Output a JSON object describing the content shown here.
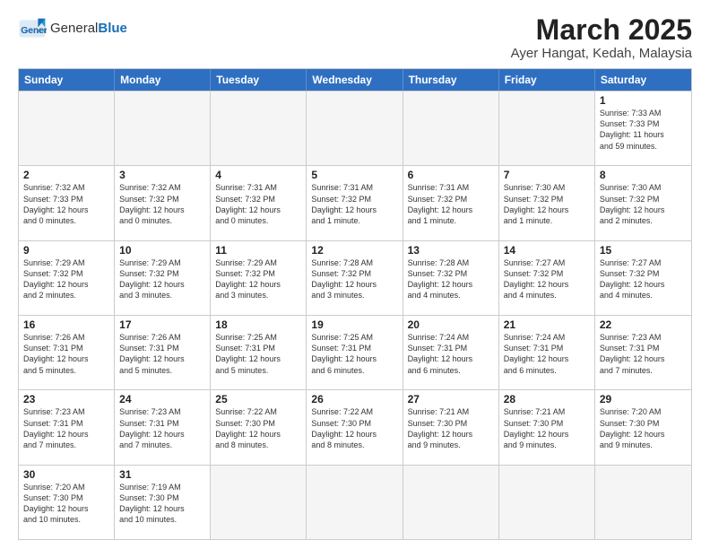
{
  "header": {
    "logo_general": "General",
    "logo_blue": "Blue",
    "month": "March 2025",
    "location": "Ayer Hangat, Kedah, Malaysia"
  },
  "weekdays": [
    "Sunday",
    "Monday",
    "Tuesday",
    "Wednesday",
    "Thursday",
    "Friday",
    "Saturday"
  ],
  "rows": [
    [
      {
        "day": "",
        "info": ""
      },
      {
        "day": "",
        "info": ""
      },
      {
        "day": "",
        "info": ""
      },
      {
        "day": "",
        "info": ""
      },
      {
        "day": "",
        "info": ""
      },
      {
        "day": "",
        "info": ""
      },
      {
        "day": "1",
        "info": "Sunrise: 7:33 AM\nSunset: 7:33 PM\nDaylight: 11 hours\nand 59 minutes."
      }
    ],
    [
      {
        "day": "2",
        "info": "Sunrise: 7:32 AM\nSunset: 7:33 PM\nDaylight: 12 hours\nand 0 minutes."
      },
      {
        "day": "3",
        "info": "Sunrise: 7:32 AM\nSunset: 7:32 PM\nDaylight: 12 hours\nand 0 minutes."
      },
      {
        "day": "4",
        "info": "Sunrise: 7:31 AM\nSunset: 7:32 PM\nDaylight: 12 hours\nand 0 minutes."
      },
      {
        "day": "5",
        "info": "Sunrise: 7:31 AM\nSunset: 7:32 PM\nDaylight: 12 hours\nand 1 minute."
      },
      {
        "day": "6",
        "info": "Sunrise: 7:31 AM\nSunset: 7:32 PM\nDaylight: 12 hours\nand 1 minute."
      },
      {
        "day": "7",
        "info": "Sunrise: 7:30 AM\nSunset: 7:32 PM\nDaylight: 12 hours\nand 1 minute."
      },
      {
        "day": "8",
        "info": "Sunrise: 7:30 AM\nSunset: 7:32 PM\nDaylight: 12 hours\nand 2 minutes."
      }
    ],
    [
      {
        "day": "9",
        "info": "Sunrise: 7:29 AM\nSunset: 7:32 PM\nDaylight: 12 hours\nand 2 minutes."
      },
      {
        "day": "10",
        "info": "Sunrise: 7:29 AM\nSunset: 7:32 PM\nDaylight: 12 hours\nand 3 minutes."
      },
      {
        "day": "11",
        "info": "Sunrise: 7:29 AM\nSunset: 7:32 PM\nDaylight: 12 hours\nand 3 minutes."
      },
      {
        "day": "12",
        "info": "Sunrise: 7:28 AM\nSunset: 7:32 PM\nDaylight: 12 hours\nand 3 minutes."
      },
      {
        "day": "13",
        "info": "Sunrise: 7:28 AM\nSunset: 7:32 PM\nDaylight: 12 hours\nand 4 minutes."
      },
      {
        "day": "14",
        "info": "Sunrise: 7:27 AM\nSunset: 7:32 PM\nDaylight: 12 hours\nand 4 minutes."
      },
      {
        "day": "15",
        "info": "Sunrise: 7:27 AM\nSunset: 7:32 PM\nDaylight: 12 hours\nand 4 minutes."
      }
    ],
    [
      {
        "day": "16",
        "info": "Sunrise: 7:26 AM\nSunset: 7:31 PM\nDaylight: 12 hours\nand 5 minutes."
      },
      {
        "day": "17",
        "info": "Sunrise: 7:26 AM\nSunset: 7:31 PM\nDaylight: 12 hours\nand 5 minutes."
      },
      {
        "day": "18",
        "info": "Sunrise: 7:25 AM\nSunset: 7:31 PM\nDaylight: 12 hours\nand 5 minutes."
      },
      {
        "day": "19",
        "info": "Sunrise: 7:25 AM\nSunset: 7:31 PM\nDaylight: 12 hours\nand 6 minutes."
      },
      {
        "day": "20",
        "info": "Sunrise: 7:24 AM\nSunset: 7:31 PM\nDaylight: 12 hours\nand 6 minutes."
      },
      {
        "day": "21",
        "info": "Sunrise: 7:24 AM\nSunset: 7:31 PM\nDaylight: 12 hours\nand 6 minutes."
      },
      {
        "day": "22",
        "info": "Sunrise: 7:23 AM\nSunset: 7:31 PM\nDaylight: 12 hours\nand 7 minutes."
      }
    ],
    [
      {
        "day": "23",
        "info": "Sunrise: 7:23 AM\nSunset: 7:31 PM\nDaylight: 12 hours\nand 7 minutes."
      },
      {
        "day": "24",
        "info": "Sunrise: 7:23 AM\nSunset: 7:31 PM\nDaylight: 12 hours\nand 7 minutes."
      },
      {
        "day": "25",
        "info": "Sunrise: 7:22 AM\nSunset: 7:30 PM\nDaylight: 12 hours\nand 8 minutes."
      },
      {
        "day": "26",
        "info": "Sunrise: 7:22 AM\nSunset: 7:30 PM\nDaylight: 12 hours\nand 8 minutes."
      },
      {
        "day": "27",
        "info": "Sunrise: 7:21 AM\nSunset: 7:30 PM\nDaylight: 12 hours\nand 9 minutes."
      },
      {
        "day": "28",
        "info": "Sunrise: 7:21 AM\nSunset: 7:30 PM\nDaylight: 12 hours\nand 9 minutes."
      },
      {
        "day": "29",
        "info": "Sunrise: 7:20 AM\nSunset: 7:30 PM\nDaylight: 12 hours\nand 9 minutes."
      }
    ],
    [
      {
        "day": "30",
        "info": "Sunrise: 7:20 AM\nSunset: 7:30 PM\nDaylight: 12 hours\nand 10 minutes."
      },
      {
        "day": "31",
        "info": "Sunrise: 7:19 AM\nSunset: 7:30 PM\nDaylight: 12 hours\nand 10 minutes."
      },
      {
        "day": "",
        "info": ""
      },
      {
        "day": "",
        "info": ""
      },
      {
        "day": "",
        "info": ""
      },
      {
        "day": "",
        "info": ""
      },
      {
        "day": "",
        "info": ""
      }
    ]
  ]
}
